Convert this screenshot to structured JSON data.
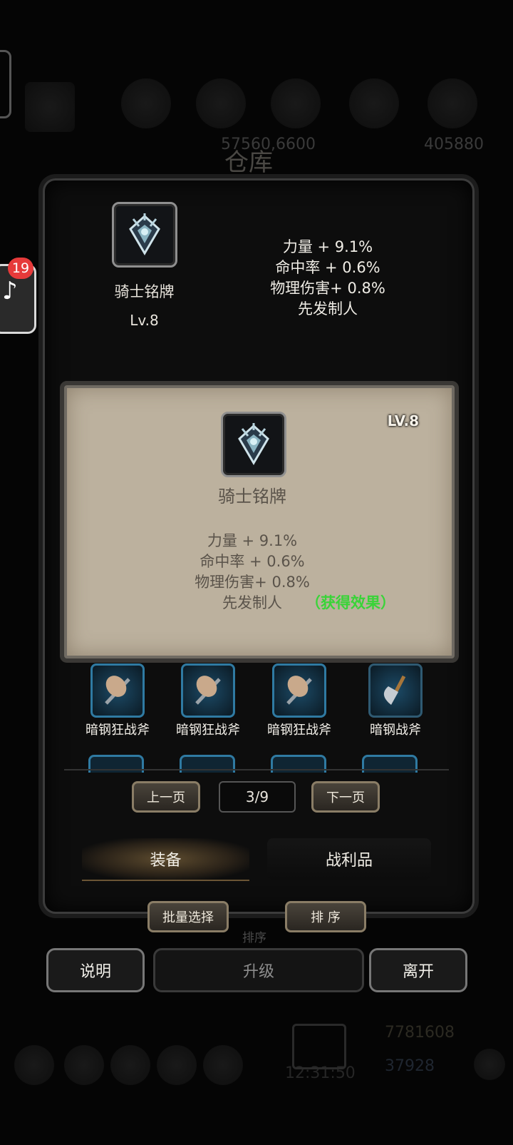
{
  "background": {
    "title": "仓库",
    "numbers": [
      "57560,6600",
      "405880"
    ],
    "gold": "7781608",
    "gems": "37928",
    "clock": "12:31:50",
    "sort_ghost": "排序"
  },
  "notification": {
    "count": "19"
  },
  "item": {
    "name": "骑士铭牌",
    "level": "Lv.8",
    "level_card": "LV.8",
    "icon": "knight-badge-icon",
    "stats": [
      "力量 + 9.1%",
      "命中率 + 0.6%",
      "物理伤害+ 0.8%",
      "先发制人"
    ],
    "effect_link": "（获得效果）"
  },
  "grid": {
    "items": [
      {
        "label": "暗钢狂战斧",
        "icon": "berserker-axe-icon"
      },
      {
        "label": "暗钢狂战斧",
        "icon": "berserker-axe-icon"
      },
      {
        "label": "暗钢狂战斧",
        "icon": "berserker-axe-icon"
      },
      {
        "label": "暗钢战斧",
        "icon": "battle-axe-icon"
      }
    ]
  },
  "pagination": {
    "prev": "上一页",
    "current": "3/9",
    "next": "下一页"
  },
  "tabs": {
    "equipment": "装备",
    "loot": "战利品"
  },
  "actions": {
    "batch_select": "批量选择",
    "sort": "排 序",
    "help": "说明",
    "upgrade": "升级",
    "leave": "离开"
  },
  "colors": {
    "effect_green": "#39d438",
    "card_bg": "#bcb19e",
    "slot_blue": "#2f7aa2"
  }
}
